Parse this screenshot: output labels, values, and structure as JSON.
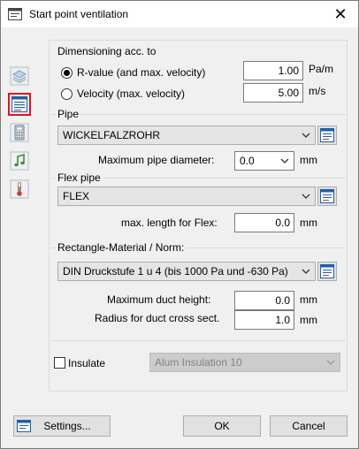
{
  "window": {
    "title": "Start point ventilation",
    "close_glyph": "✕"
  },
  "icons": {
    "app": "app-window-icon",
    "layers": "layers-icon",
    "table": "table-icon",
    "calculator": "calculator-icon",
    "music": "music-note-icon",
    "thermometer": "thermometer-icon"
  },
  "colors": {
    "selected_border": "#e0141e",
    "table_icon": "#1f5fa8"
  },
  "dimensioning": {
    "label": "Dimensioning acc. to",
    "rvalue": {
      "label": "R-value (and max. velocity)",
      "value": "1.00",
      "unit": "Pa/m",
      "selected": true
    },
    "velocity": {
      "label": "Velocity (max. velocity)",
      "value": "5.00",
      "unit": "m/s",
      "selected": false
    }
  },
  "pipe": {
    "label": "Pipe",
    "selected": "WICKELFALZROHR",
    "max_diameter": {
      "label": "Maximum pipe diameter:",
      "value": "0.0",
      "unit": "mm"
    }
  },
  "flex": {
    "label": "Flex pipe",
    "selected": "FLEX",
    "max_length": {
      "label": "max. length for Flex:",
      "value": "0.0",
      "unit": "mm"
    }
  },
  "rect": {
    "label": "Rectangle-Material / Norm:",
    "selected": "DIN Druckstufe 1 u 4 (bis 1000 Pa und -630 Pa)",
    "max_height": {
      "label": "Maximum duct height:",
      "value": "0.0",
      "unit": "mm"
    },
    "radius": {
      "label": "Radius for duct cross sect.",
      "value": "1.0",
      "unit": "mm"
    }
  },
  "insulate": {
    "label": "Insulate",
    "checked": false,
    "selected": "Alum Insulation 10"
  },
  "buttons": {
    "settings": "Settings...",
    "ok": "OK",
    "cancel": "Cancel"
  }
}
